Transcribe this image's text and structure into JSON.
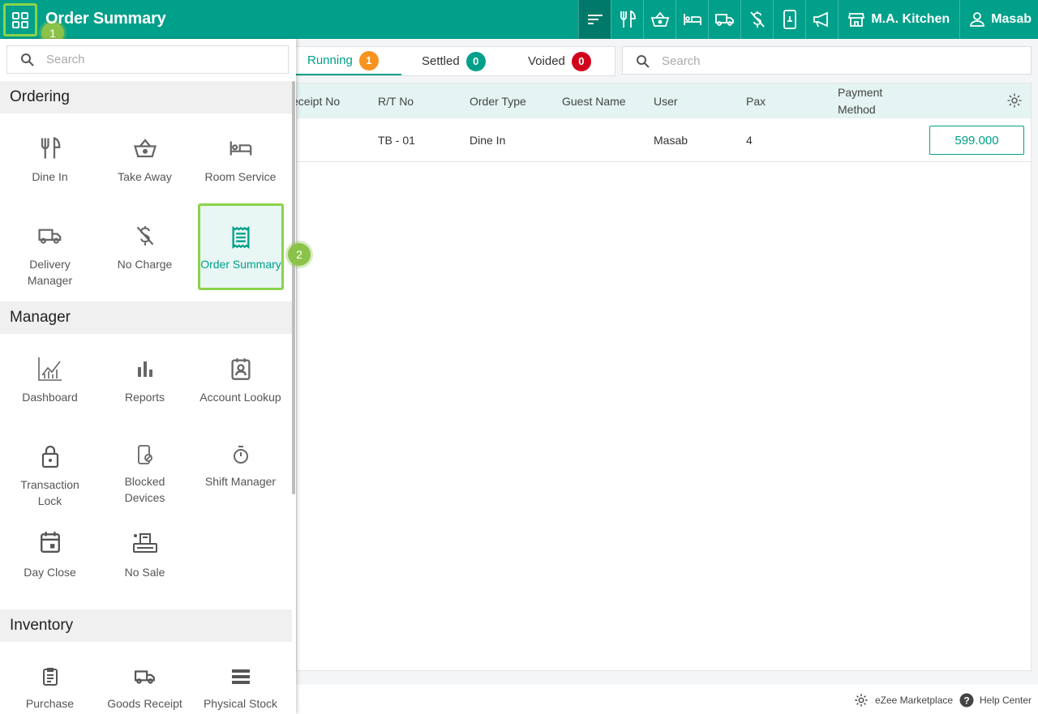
{
  "header": {
    "title": "Order Summary",
    "store_label": "M.A. Kitchen",
    "user_label": "Masab",
    "step1": "1",
    "step2": "2"
  },
  "sidebar": {
    "search_placeholder": "Search",
    "sections": {
      "ordering": "Ordering",
      "manager": "Manager",
      "inventory": "Inventory"
    },
    "ordering_items": [
      "Dine In",
      "Take Away",
      "Room Service",
      "Delivery Manager",
      "No Charge",
      "Order Summary"
    ],
    "manager_items": [
      "Dashboard",
      "Reports",
      "Account Lookup",
      "Transaction Lock",
      "Blocked Devices",
      "Shift Manager",
      "Day Close",
      "No Sale"
    ],
    "inventory_items": [
      "Purchase",
      "Goods Receipt",
      "Physical Stock"
    ]
  },
  "tabs": {
    "running": {
      "label": "Running",
      "count": "1"
    },
    "settled": {
      "label": "Settled",
      "count": "0"
    },
    "voided": {
      "label": "Voided",
      "count": "0"
    }
  },
  "search": {
    "placeholder": "Search"
  },
  "table": {
    "columns": [
      "eceipt No",
      "R/T No",
      "Order Type",
      "Guest Name",
      "User",
      "Pax",
      "Payment",
      "Method"
    ],
    "row": {
      "rt_no": "TB - 01",
      "order_type": "Dine In",
      "user": "Masab",
      "pax": "4",
      "amount": "599.000"
    }
  },
  "footer": {
    "marketplace": "eZee Marketplace",
    "help": "Help Center"
  },
  "colors": {
    "brand": "#00a08a",
    "brand_dark": "#00796b",
    "highlight": "#8bd34a",
    "running_badge": "#f7931e",
    "settled_badge": "#00a08a",
    "voided_badge": "#d0021b"
  }
}
